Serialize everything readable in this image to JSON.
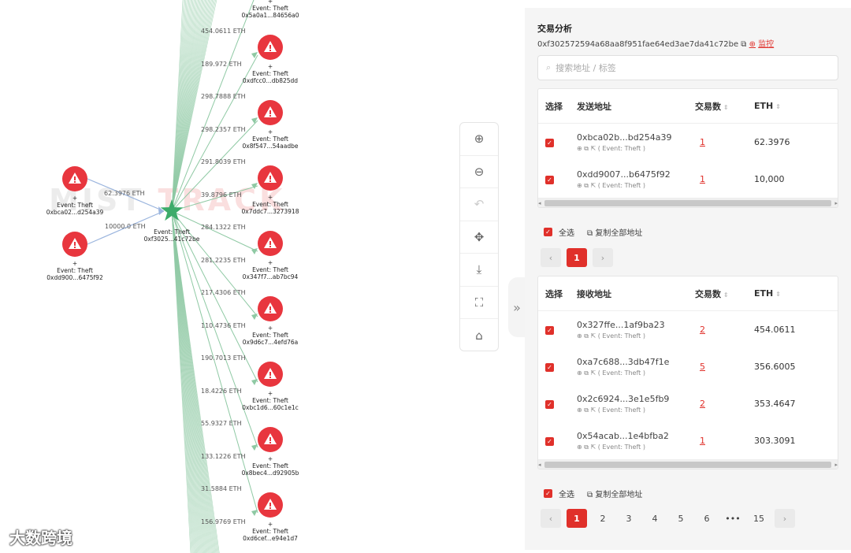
{
  "graph": {
    "watermark_left": "MIST",
    "watermark_right": "TRACK",
    "brand": "大数跨境",
    "center": {
      "line1": "Event: Theft",
      "line2": "0xf3025...41c72be"
    },
    "sources": [
      {
        "line1": "Event: Theft",
        "line2": "0xbca02...d254a39",
        "amount": "62.3976 ETH"
      },
      {
        "line1": "Event: Theft",
        "line2": "0xdd900...6475f92",
        "amount": "10000.0 ETH"
      }
    ],
    "targets": [
      {
        "line1": "Event: Theft",
        "line2": "0x5a0a1...84656a0",
        "amount": "454.0611 ETH"
      },
      {
        "line1": "Event: Theft",
        "line2": "0xdfcc0...db825dd",
        "amount": "189.972 ETH"
      },
      {
        "line1": "Event: Theft",
        "line2": "0x8f547...54aadbe",
        "amount": "298.7888 ETH"
      },
      {
        "line1": "Event: Theft",
        "line2": "0x7ddc7...3273918",
        "amount": "298.2357 ETH"
      },
      {
        "line1": "Event: Theft",
        "line2": "0x347f7...ab7bc94",
        "amount": "291.8039 ETH"
      },
      {
        "line1": "Event: Theft",
        "line2": "0x9d6c7...4efd76a",
        "amount": "39.8796 ETH"
      },
      {
        "line1": "Event: Theft",
        "line2": "0xbc1d6...60c1e1c",
        "amount": "284.1322 ETH"
      },
      {
        "line1": "Event: Theft",
        "line2": "0x8bec4...d92905b",
        "amount": "281.2235 ETH"
      },
      {
        "line1": "Event: Theft",
        "line2": "0xd6cef...e94e1d7",
        "amount": "217.4306 ETH"
      }
    ],
    "extra_amounts": [
      "110.4736 ETH",
      "190.7013 ETH",
      "18.4226 ETH",
      "55.9327 ETH",
      "133.1226 ETH",
      "31.5884 ETH",
      "156.9769 ETH"
    ],
    "cross": "+"
  },
  "toolbar": {
    "items": [
      {
        "name": "zoom-in-icon",
        "glyph": "⊕"
      },
      {
        "name": "zoom-out-icon",
        "glyph": "⊖"
      },
      {
        "name": "undo-icon",
        "glyph": "↶"
      },
      {
        "name": "move-icon",
        "glyph": "✥"
      },
      {
        "name": "download-icon",
        "glyph": "⤓"
      },
      {
        "name": "fullscreen-icon",
        "glyph": "⛶"
      },
      {
        "name": "robot-icon",
        "glyph": "⌂"
      }
    ],
    "collapse_glyph": "»"
  },
  "panel": {
    "title": "交易分析",
    "address": "0xf302572594a68aa8f951fae64ed3ae7da41c72be",
    "monitor": "监控",
    "search_placeholder": "搜索地址 / 标签",
    "select_all": "全选",
    "copy_all": "复制全部地址",
    "send_table": {
      "headers": {
        "select": "选择",
        "address": "发送地址",
        "count": "交易数",
        "eth": "ETH"
      },
      "rows": [
        {
          "address": "0xbca02b...bd254a39",
          "tag": "( Event: Theft )",
          "count": "1",
          "eth": "62.3976"
        },
        {
          "address": "0xdd9007...b6475f92",
          "tag": "( Event: Theft )",
          "count": "1",
          "eth": "10,000"
        }
      ],
      "pages": [
        "1"
      ]
    },
    "recv_table": {
      "headers": {
        "select": "选择",
        "address": "接收地址",
        "count": "交易数",
        "eth": "ETH"
      },
      "rows": [
        {
          "address": "0x327ffe...1af9ba23",
          "tag": "( Event: Theft )",
          "count": "2",
          "eth": "454.0611"
        },
        {
          "address": "0xa7c688...3db47f1e",
          "tag": "( Event: Theft )",
          "count": "5",
          "eth": "356.6005"
        },
        {
          "address": "0x2c6924...3e1e5fb9",
          "tag": "( Event: Theft )",
          "count": "2",
          "eth": "353.4647"
        },
        {
          "address": "0x54acab...1e4bfba2",
          "tag": "( Event: Theft )",
          "count": "1",
          "eth": "303.3091"
        }
      ],
      "pages": [
        "1",
        "2",
        "3",
        "4",
        "5",
        "6",
        "•••",
        "15"
      ]
    },
    "colors": {
      "accent": "#e0302a",
      "node_red": "#e8363e",
      "center_green": "#3dab6a",
      "edge_green": "#8fc9a4",
      "edge_blue": "#9bb5de"
    }
  }
}
